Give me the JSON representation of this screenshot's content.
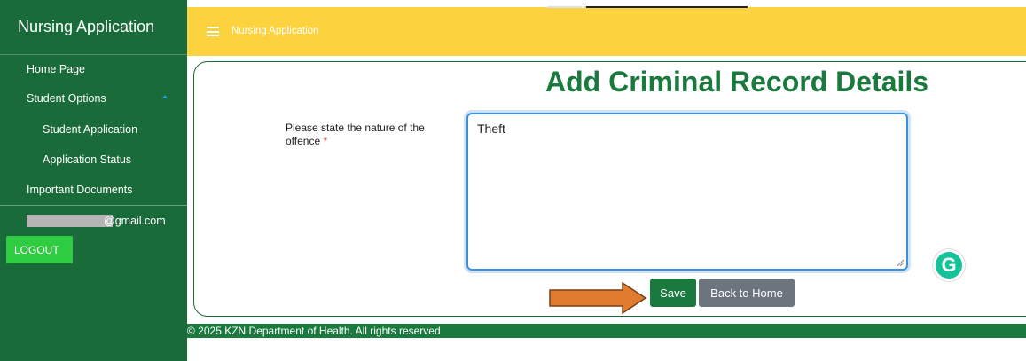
{
  "sidebar": {
    "brand": "Nursing Application",
    "items": {
      "home": "Home Page",
      "student_options": "Student Options",
      "student_application": "Student Application",
      "application_status": "Application Status",
      "important_documents": "Important Documents"
    },
    "email_suffix": "gmail.com",
    "logout": "LOGOUT"
  },
  "topbar": {
    "title": "Nursing Application"
  },
  "form": {
    "heading": "Add Criminal Record Details",
    "offence_label": "Please state the nature of the offence",
    "required_mark": "*",
    "offence_value": "Theft"
  },
  "buttons": {
    "save": "Save",
    "back": "Back to Home"
  },
  "footer": {
    "text": "© 2025 KZN Department of Health. All rights reserved"
  },
  "colors": {
    "sidebar": "#1a6b3a",
    "topbar": "#fcd23f",
    "primary": "#1a7a3e",
    "logout": "#2ecc40",
    "secondary_button": "#6c757d",
    "annotation_arrow": "#e07b30"
  },
  "icons": {
    "menu": "hamburger-icon",
    "collapse": "caret-up-icon",
    "grammarly": "grammarly-icon",
    "annotation": "arrow-right-icon"
  }
}
